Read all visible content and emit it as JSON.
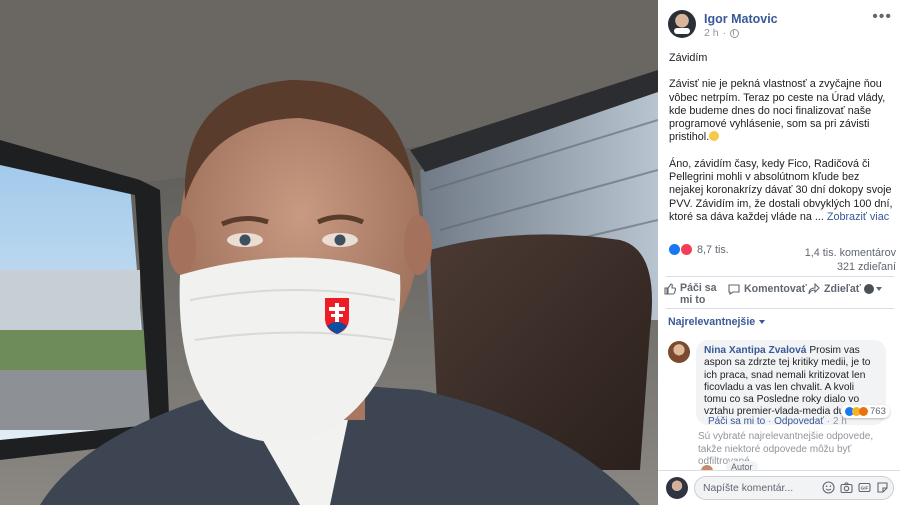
{
  "photo": {
    "description_icon": "selfie-photo",
    "flag_icon": "slovak-coat-of-arms-icon"
  },
  "post": {
    "author": "Igor Matovic",
    "time": "2 h",
    "privacy_icon": "globe-icon",
    "more_icon": "more-options-icon",
    "title": "Závidím",
    "para1": "Závisť nie je pekná vlastnosť a zvyčajne ňou vôbec netrpím. Teraz po ceste na Úrad vlády, kde budeme dnes do noci finalizovať naše programové vyhlásenie, som sa pri závisti pristihol.",
    "para2": "Áno, závidím časy, kedy Fico, Radičová či Pellegrini mohli v absolútnom kľude bez nejakej koronakrízy dávať 30 dní dokopy svoje PVV. Závidím im, že dostali obvyklých 100 dní, ktoré sa dáva každej vláde na ...",
    "see_more": "Zobraziť viac"
  },
  "stats": {
    "reactions_count": "8,7 tis.",
    "comments": "1,4 tis. komentárov",
    "views": "321 zdieľaní"
  },
  "actions": {
    "like": "Páči sa mi to",
    "comment": "Komentovať",
    "share": "Zdieľať"
  },
  "sort": {
    "label": "Najrelevantnejšie"
  },
  "comment": {
    "name": "Nina Xantipa Zvalová",
    "text": "Prosim vas aspon sa zdrzte tej kritiky medii, je to ich praca, snad nemali kritizovat len ficovladu a vas len chvalit. A kvoli tomu co sa Posledne roky dialo vo vztahu premier-vlada-media duplom.",
    "reactions_count": "763",
    "like_label": "Páči sa mi to",
    "reply_label": "Odpovedať",
    "time": "2 h"
  },
  "note": "Sú vybraté najrelevantnejšie odpovede, takže niektoré odpovede môžu byť odfiltrované.",
  "reply_peek": {
    "label": "Autor"
  },
  "composer": {
    "placeholder": "Napíšte komentár..."
  },
  "colors": {
    "link": "#385898",
    "muted": "#606770",
    "bubble": "#f2f3f5",
    "like_blue": "#1877f2",
    "love_red": "#f33e58"
  }
}
